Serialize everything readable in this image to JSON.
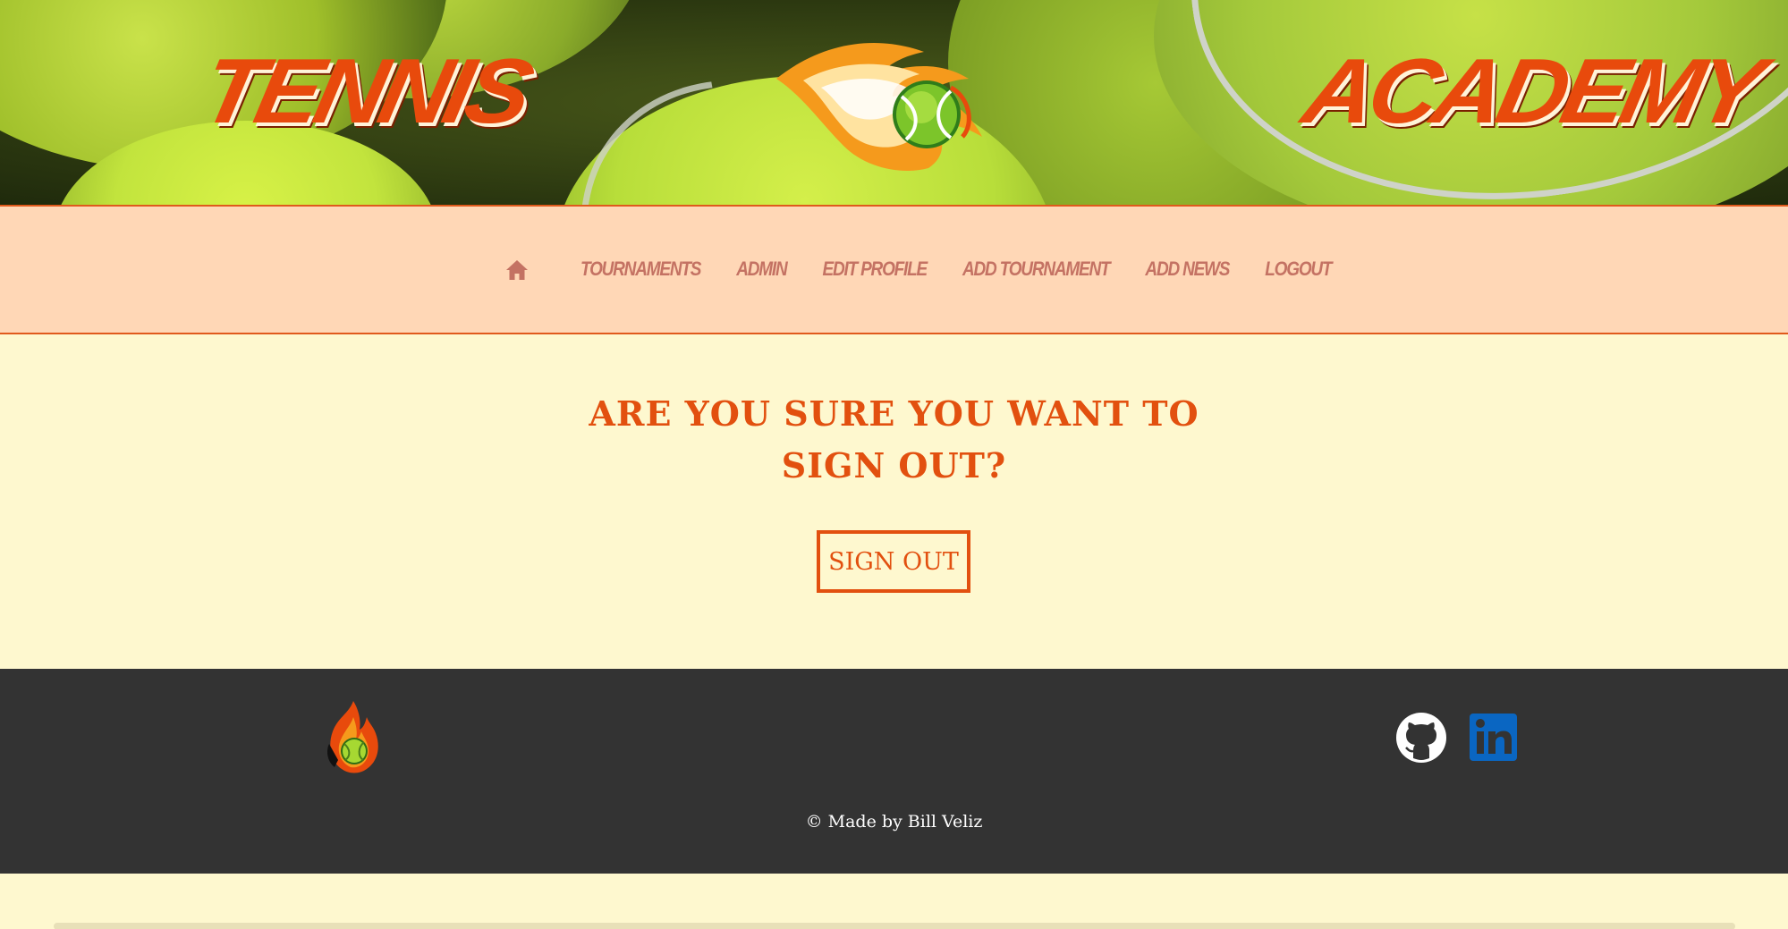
{
  "banner": {
    "left_word": "TENNIS",
    "right_word": "ACADEMY",
    "logo_icon": "flaming-tennis-ball"
  },
  "nav": {
    "home_icon": "home-icon",
    "items": [
      {
        "label": "TOURNAMENTS"
      },
      {
        "label": "ADMIN"
      },
      {
        "label": "EDIT PROFILE"
      },
      {
        "label": "ADD TOURNAMENT"
      },
      {
        "label": "ADD NEWS"
      },
      {
        "label": "LOGOUT"
      }
    ]
  },
  "main": {
    "heading_line1": "ARE YOU SURE YOU WANT TO",
    "heading_line2": "SIGN OUT?",
    "button_label": "SIGN OUT"
  },
  "footer": {
    "logo_icon": "fire-tennis-ball",
    "social": [
      "github-icon",
      "linkedin-icon"
    ],
    "copyright": "© Made by Bill Veliz"
  },
  "colors": {
    "accent": "#e2500f",
    "nav_bg": "#ffd7b6",
    "page_bg": "#fef8cf",
    "footer_bg": "#333333",
    "nav_text": "#c47263",
    "linkedin": "#0a66c2"
  }
}
